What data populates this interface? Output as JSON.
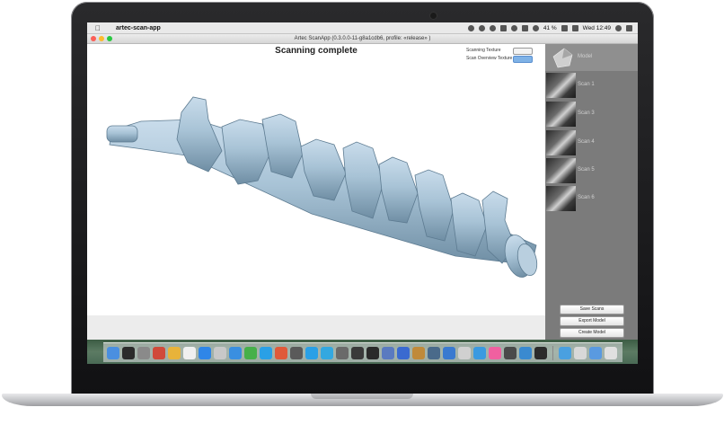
{
  "menubar": {
    "app_name": "artec-scan-app",
    "clock": "Wed 12:49",
    "battery": "41 %"
  },
  "window": {
    "title": "Artec ScanApp (0.3.0.0-11-g8a1cdb6, profile: «release» )"
  },
  "main": {
    "status_title": "Scanning complete",
    "scanning_texture_label": "Scanning Texture",
    "scan_overview_texture_label": "Scan Overview Texture"
  },
  "sidebar": {
    "items": [
      {
        "label": "Model"
      },
      {
        "label": "Scan 1"
      },
      {
        "label": "Scan 3"
      },
      {
        "label": "Scan 4"
      },
      {
        "label": "Scan 5"
      },
      {
        "label": "Scan 6"
      }
    ],
    "buttons": {
      "save_scans": "Save Scans",
      "export_model": "Export Model",
      "create_model": "Create Model"
    }
  },
  "colors": {
    "model_surface": "#a8c3d6",
    "accent_toggle": "#7fb2e6"
  },
  "dock_icons": [
    "finder-icon",
    "terminal-icon",
    "launchpad-icon",
    "app-icon",
    "chrome-icon",
    "photos-icon",
    "app-store-icon",
    "app-icon",
    "safari-icon",
    "qt-icon",
    "skype-icon",
    "app-icon",
    "app-icon",
    "app-icon",
    "telegram-icon",
    "app-icon",
    "app-icon",
    "app-icon",
    "app-icon",
    "app-icon",
    "app-icon",
    "app-icon",
    "app-icon",
    "app-icon",
    "app-icon",
    "itunes-icon",
    "app-icon",
    "xcode-icon",
    "terminal-icon",
    "folder-icon",
    "folder-icon",
    "finder-icon",
    "trash-icon"
  ]
}
